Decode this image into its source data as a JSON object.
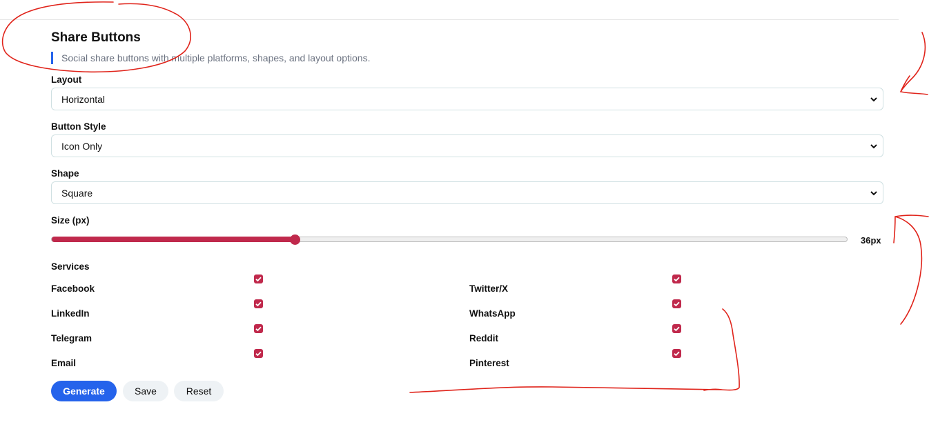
{
  "header": {
    "title": "Share Buttons",
    "subtitle": "Social share buttons with multiple platforms, shapes, and layout options."
  },
  "form": {
    "layout": {
      "label": "Layout",
      "value": "Horizontal"
    },
    "button_style": {
      "label": "Button Style",
      "value": "Icon Only"
    },
    "shape": {
      "label": "Shape",
      "value": "Square"
    },
    "size": {
      "label": "Size (px)",
      "value_text": "36px",
      "fill_fraction": 0.306
    }
  },
  "services": {
    "label": "Services",
    "items": [
      {
        "name": "Facebook",
        "checked": true
      },
      {
        "name": "Twitter/X",
        "checked": true
      },
      {
        "name": "LinkedIn",
        "checked": true
      },
      {
        "name": "WhatsApp",
        "checked": true
      },
      {
        "name": "Telegram",
        "checked": true
      },
      {
        "name": "Reddit",
        "checked": true
      },
      {
        "name": "Email",
        "checked": true
      },
      {
        "name": "Pinterest",
        "checked": true
      }
    ]
  },
  "actions": {
    "generate": "Generate",
    "save": "Save",
    "reset": "Reset"
  },
  "colors": {
    "accent": "#c0294c",
    "primary": "#2563eb",
    "annotation": "#e0241b"
  },
  "icons": {
    "select_caret": "chevron-down-icon",
    "checkbox_mark": "check-icon"
  }
}
